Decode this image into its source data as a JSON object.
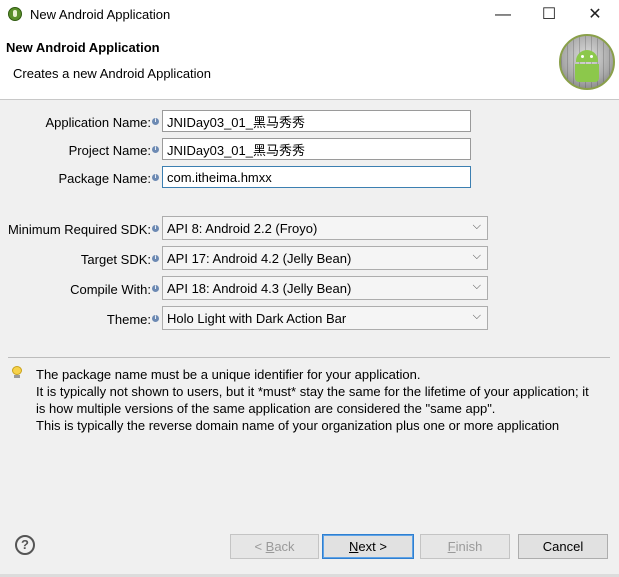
{
  "window": {
    "title": "New Android Application",
    "minimize_glyph": "—",
    "maximize_glyph": "☐",
    "close_glyph": "✕"
  },
  "header": {
    "title": "New Android Application",
    "subtitle": "Creates a new Android Application",
    "logo_icon": "android-logo-icon"
  },
  "form": {
    "application_name_label": "Application Name:",
    "application_name_value": "JNIDay03_01_黑马秀秀",
    "project_name_label": "Project Name:",
    "project_name_value": "JNIDay03_01_黑马秀秀",
    "package_name_label": "Package Name:",
    "package_name_value": "com.itheima.hmxx",
    "min_sdk_label": "Minimum Required SDK:",
    "min_sdk_value": "API 8: Android 2.2 (Froyo)",
    "target_sdk_label": "Target SDK:",
    "target_sdk_value": "API 17: Android 4.2 (Jelly Bean)",
    "compile_with_label": "Compile With:",
    "compile_with_value": "API 18: Android 4.3 (Jelly Bean)",
    "theme_label": "Theme:",
    "theme_value": "Holo Light with Dark Action Bar",
    "info_glyph": "i"
  },
  "help": {
    "lines": [
      "The package name must be a unique identifier for your application.",
      "It is typically not shown to users, but it *must* stay the same for the lifetime of your application; it",
      "is how multiple versions of the same application are considered the \"same app\".",
      "This is typically the reverse domain name of your organization plus one or more application"
    ]
  },
  "buttons": {
    "help": "?",
    "back_prefix": "< ",
    "back_mnemonic": "B",
    "back_rest": "ack",
    "next_mnemonic": "N",
    "next_rest": "ext >",
    "finish_mnemonic": "F",
    "finish_rest": "inish",
    "cancel": "Cancel"
  },
  "colors": {
    "accent": "#2f7fd0",
    "android_green": "#8cc84b"
  }
}
